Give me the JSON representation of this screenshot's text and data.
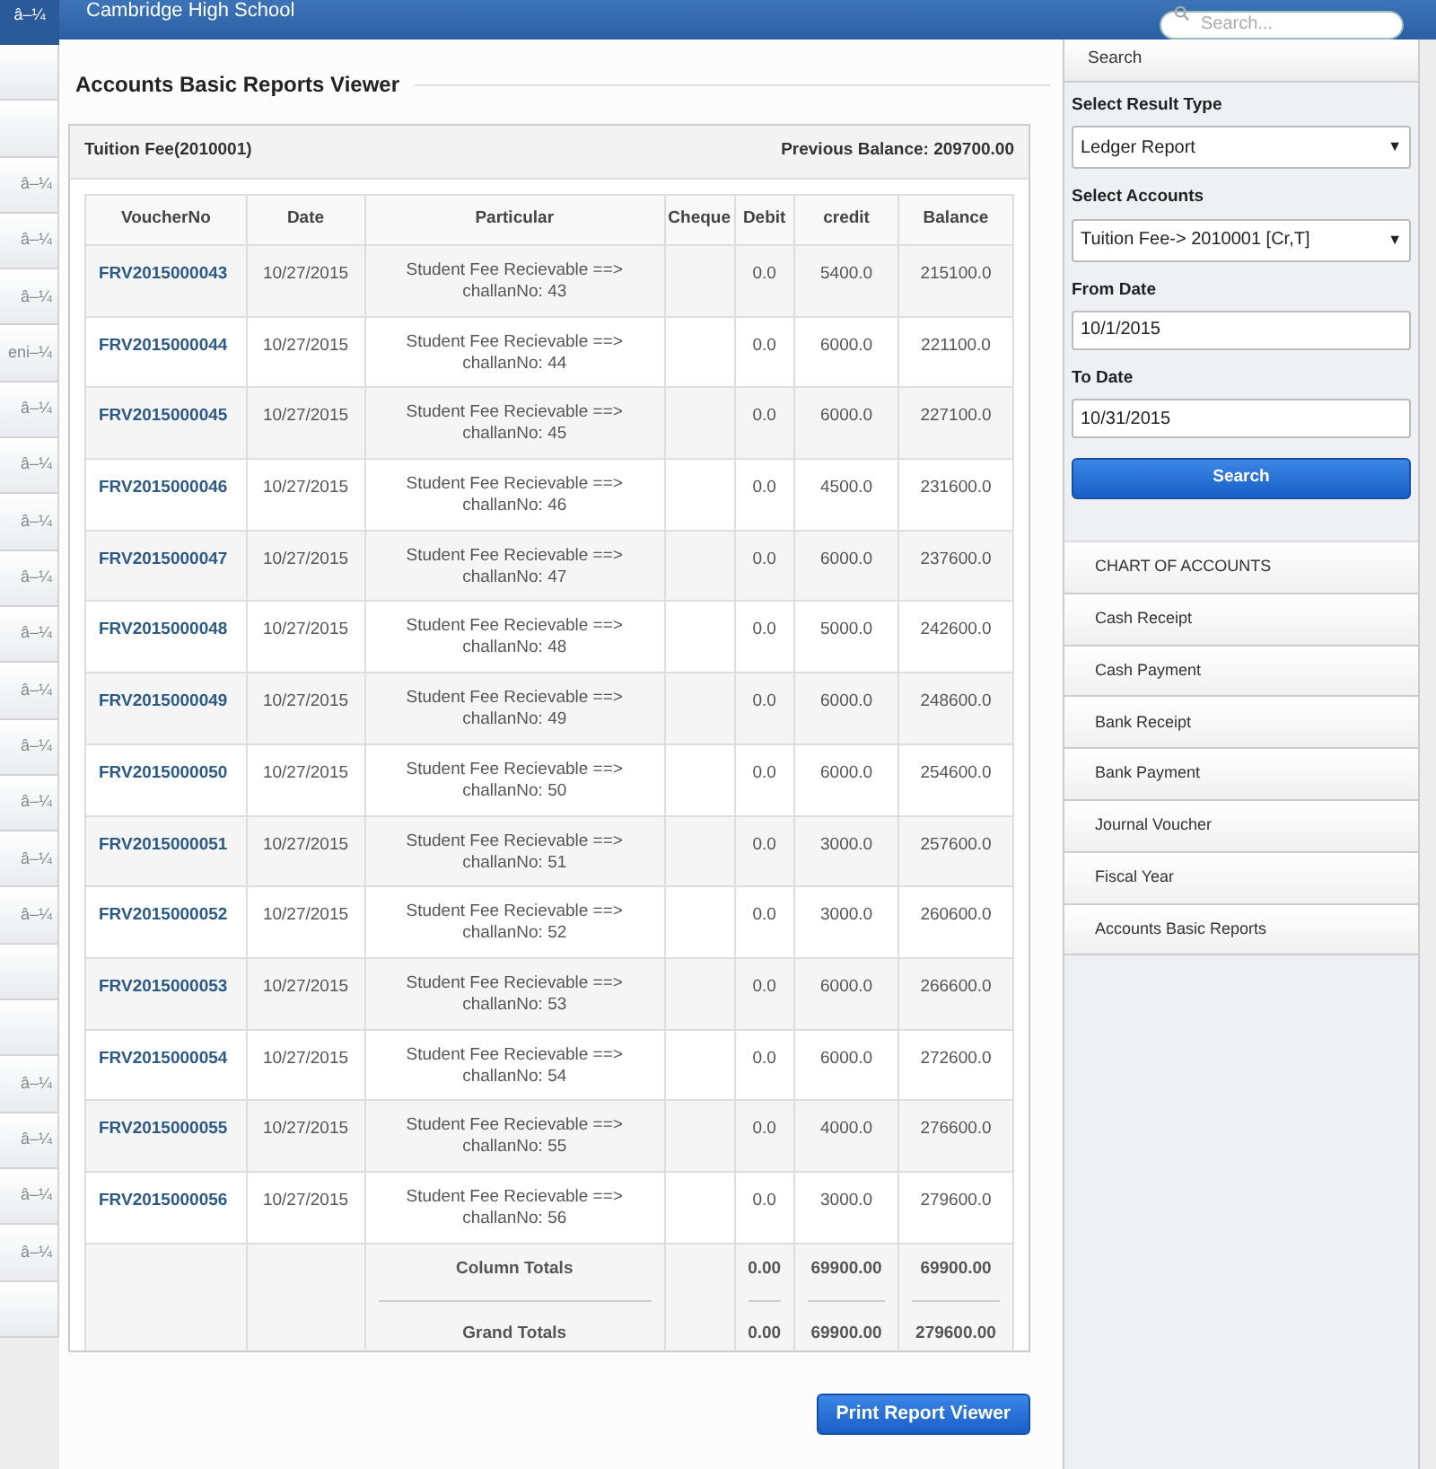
{
  "header": {
    "menu_toggle": "â–¼",
    "title": "Cambridge High School",
    "search": {
      "placeholder": "Search..."
    }
  },
  "left_menu": [
    {
      "kind": "blank"
    },
    {
      "kind": "blank"
    },
    {
      "kind": "labeled",
      "label": "â–¼"
    },
    {
      "kind": "labeled",
      "label": "â–¼"
    },
    {
      "kind": "labeled",
      "label": "â–¼"
    },
    {
      "kind": "labeled",
      "label": "eni–¼"
    },
    {
      "kind": "labeled",
      "label": "â–¼"
    },
    {
      "kind": "labeled",
      "label": "â–¼"
    },
    {
      "kind": "labeled",
      "label": "â–¼"
    },
    {
      "kind": "labeled",
      "label": "â–¼"
    },
    {
      "kind": "labeled",
      "label": "â–¼"
    },
    {
      "kind": "labeled",
      "label": "â–¼"
    },
    {
      "kind": "labeled",
      "label": "â–¼"
    },
    {
      "kind": "labeled",
      "label": "â–¼"
    },
    {
      "kind": "labeled",
      "label": "â–¼"
    },
    {
      "kind": "labeled",
      "label": "â–¼"
    },
    {
      "kind": "blank"
    },
    {
      "kind": "blank"
    },
    {
      "kind": "labeled",
      "label": "â–¼"
    },
    {
      "kind": "labeled",
      "label": "â–¼"
    },
    {
      "kind": "labeled",
      "label": "â–¼"
    },
    {
      "kind": "labeled",
      "label": "â–¼"
    },
    {
      "kind": "blank"
    }
  ],
  "page_title": "Accounts Basic Reports Viewer",
  "report": {
    "account": "Tuition Fee(2010001)",
    "previous_balance": "Previous Balance: 209700.00",
    "columns": [
      "VoucherNo",
      "Date",
      "Particular",
      "Cheque",
      "Debit",
      "credit",
      "Balance"
    ],
    "rows": [
      {
        "voucher": "FRV2015000043",
        "date": "10/27/2015",
        "particular": "Student Fee Recievable ==> challanNo: 43",
        "debit": "0.0",
        "credit": "5400.0",
        "balance": "215100.0"
      },
      {
        "voucher": "FRV2015000044",
        "date": "10/27/2015",
        "particular": "Student Fee Recievable ==> challanNo: 44",
        "debit": "0.0",
        "credit": "6000.0",
        "balance": "221100.0"
      },
      {
        "voucher": "FRV2015000045",
        "date": "10/27/2015",
        "particular": "Student Fee Recievable ==> challanNo: 45",
        "debit": "0.0",
        "credit": "6000.0",
        "balance": "227100.0"
      },
      {
        "voucher": "FRV2015000046",
        "date": "10/27/2015",
        "particular": "Student Fee Recievable ==> challanNo: 46",
        "debit": "0.0",
        "credit": "4500.0",
        "balance": "231600.0"
      },
      {
        "voucher": "FRV2015000047",
        "date": "10/27/2015",
        "particular": "Student Fee Recievable ==> challanNo: 47",
        "debit": "0.0",
        "credit": "6000.0",
        "balance": "237600.0"
      },
      {
        "voucher": "FRV2015000048",
        "date": "10/27/2015",
        "particular": "Student Fee Recievable ==> challanNo: 48",
        "debit": "0.0",
        "credit": "5000.0",
        "balance": "242600.0"
      },
      {
        "voucher": "FRV2015000049",
        "date": "10/27/2015",
        "particular": "Student Fee Recievable ==> challanNo: 49",
        "debit": "0.0",
        "credit": "6000.0",
        "balance": "248600.0"
      },
      {
        "voucher": "FRV2015000050",
        "date": "10/27/2015",
        "particular": "Student Fee Recievable ==> challanNo: 50",
        "debit": "0.0",
        "credit": "6000.0",
        "balance": "254600.0"
      },
      {
        "voucher": "FRV2015000051",
        "date": "10/27/2015",
        "particular": "Student Fee Recievable ==> challanNo: 51",
        "debit": "0.0",
        "credit": "3000.0",
        "balance": "257600.0"
      },
      {
        "voucher": "FRV2015000052",
        "date": "10/27/2015",
        "particular": "Student Fee Recievable ==> challanNo: 52",
        "debit": "0.0",
        "credit": "3000.0",
        "balance": "260600.0"
      },
      {
        "voucher": "FRV2015000053",
        "date": "10/27/2015",
        "particular": "Student Fee Recievable ==> challanNo: 53",
        "debit": "0.0",
        "credit": "6000.0",
        "balance": "266600.0"
      },
      {
        "voucher": "FRV2015000054",
        "date": "10/27/2015",
        "particular": "Student Fee Recievable ==> challanNo: 54",
        "debit": "0.0",
        "credit": "6000.0",
        "balance": "272600.0"
      },
      {
        "voucher": "FRV2015000055",
        "date": "10/27/2015",
        "particular": "Student Fee Recievable ==> challanNo: 55",
        "debit": "0.0",
        "credit": "4000.0",
        "balance": "276600.0"
      },
      {
        "voucher": "FRV2015000056",
        "date": "10/27/2015",
        "particular": "Student Fee Recievable ==> challanNo: 56",
        "debit": "0.0",
        "credit": "3000.0",
        "balance": "279600.0"
      }
    ],
    "totals": [
      {
        "label": "Column Totals",
        "debit": "0.00",
        "credit": "69900.00",
        "balance": "69900.00"
      },
      {
        "label": "Grand Totals",
        "debit": "0.00",
        "credit": "69900.00",
        "balance": "279600.00"
      }
    ]
  },
  "print_button": "Print Report Viewer",
  "search_panel": {
    "tab": "Search",
    "fields": [
      {
        "kind": "select",
        "label": "Select Result Type",
        "value": "Ledger Report",
        "arrow": "▼"
      },
      {
        "kind": "select",
        "label": "Select Accounts",
        "value": "Tuition Fee-> 2010001 [Cr,T]",
        "arrow": "▼"
      },
      {
        "kind": "text",
        "label": "From Date",
        "value": "10/1/2015"
      },
      {
        "kind": "text",
        "label": "To Date",
        "value": "10/31/2015"
      }
    ],
    "button": "Search"
  },
  "nav": [
    "CHART OF ACCOUNTS",
    "Cash Receipt",
    "Cash Payment",
    "Bank Receipt",
    "Bank Payment",
    "Journal Voucher",
    "Fiscal Year",
    "Accounts Basic Reports"
  ]
}
